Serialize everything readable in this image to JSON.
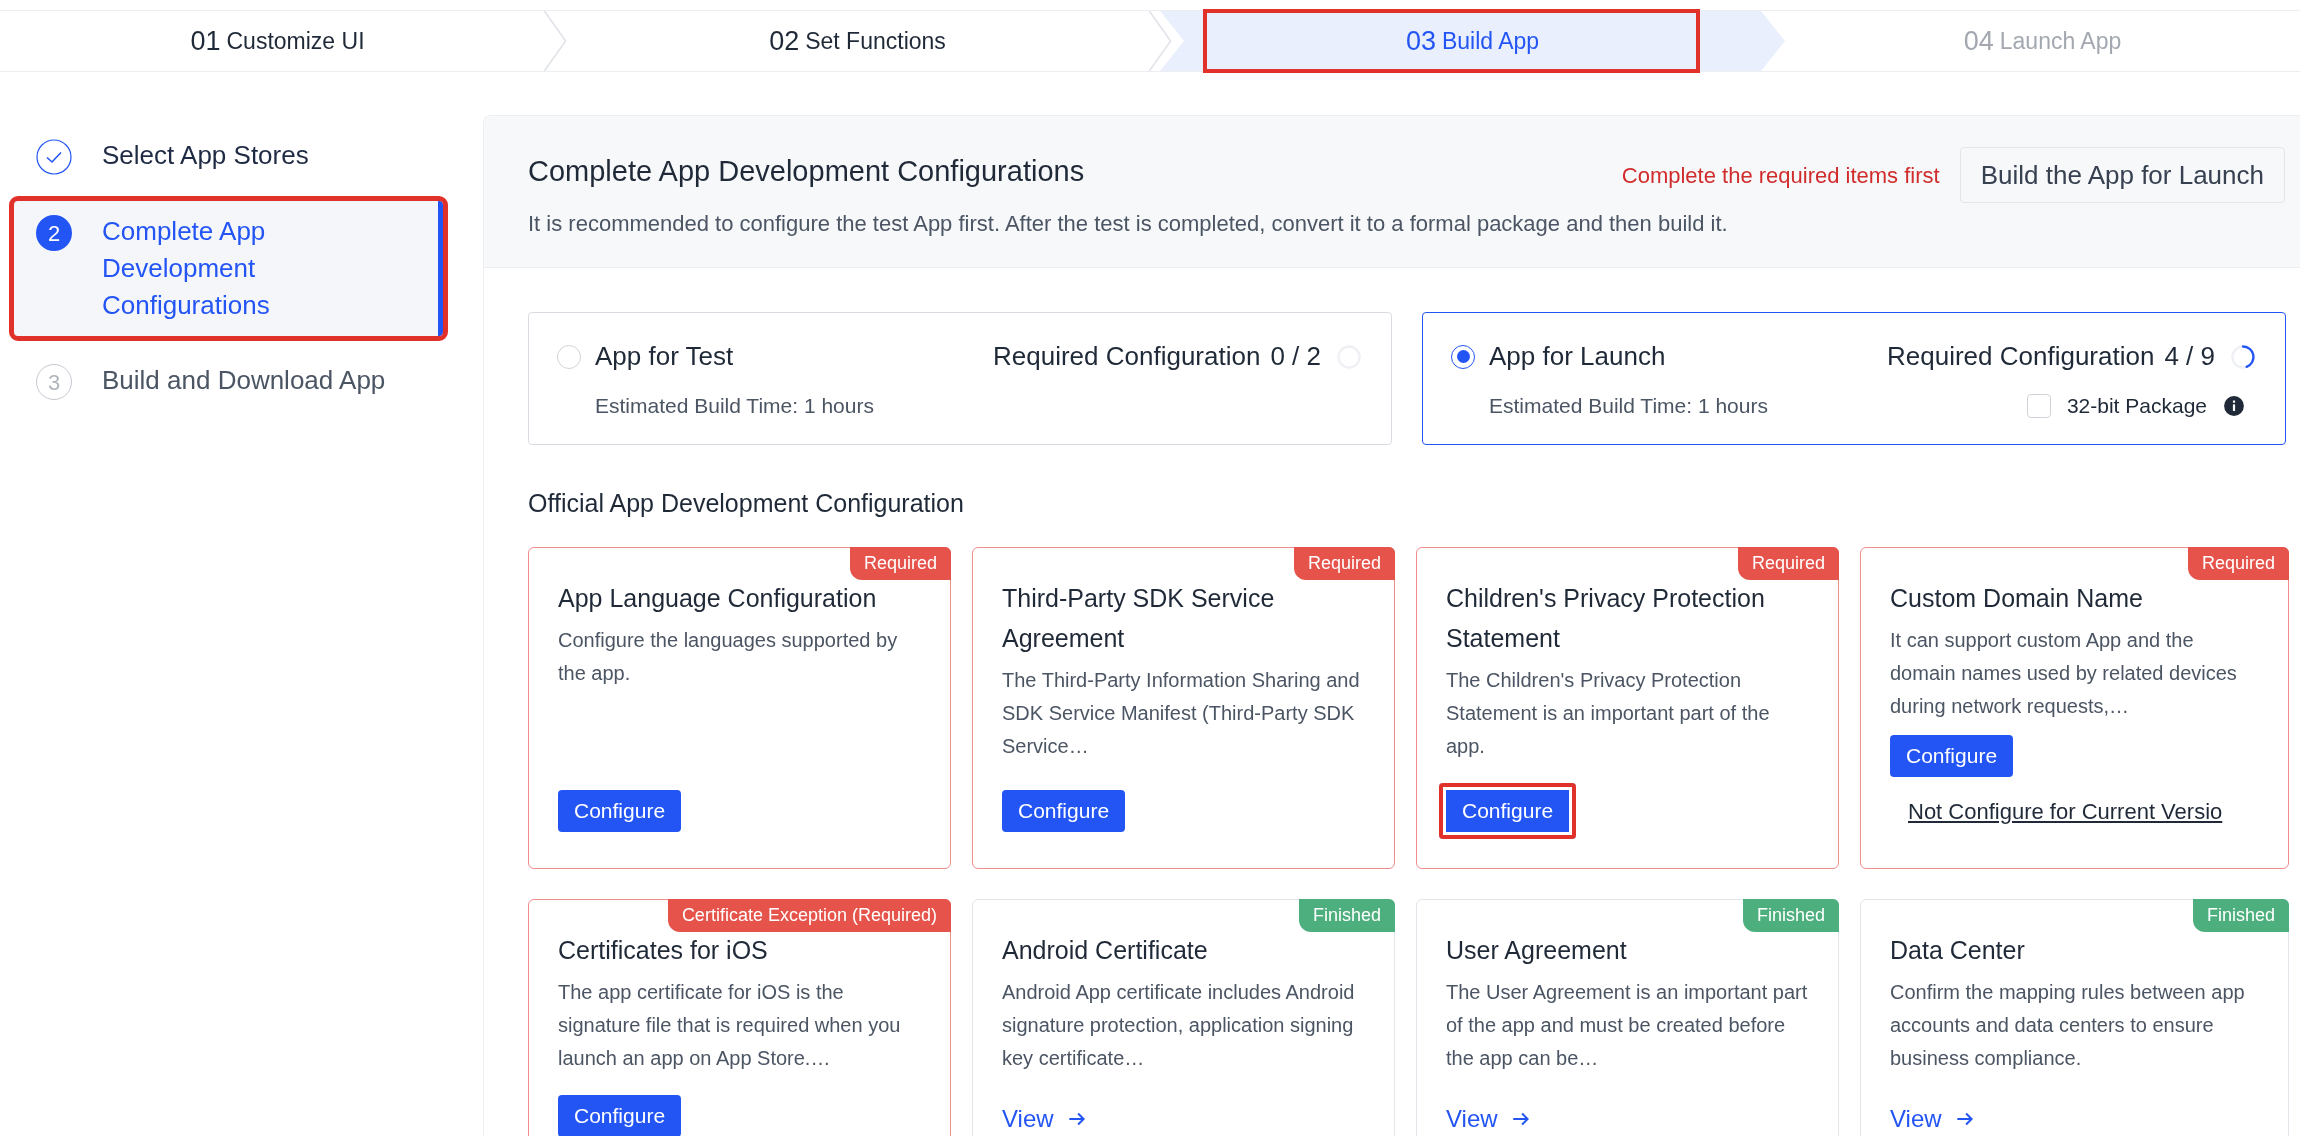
{
  "steps": [
    {
      "number": "01",
      "label": "Customize UI",
      "selected": false,
      "disabled": false,
      "highlighted": false
    },
    {
      "number": "02",
      "label": "Set Functions",
      "selected": false,
      "disabled": false,
      "highlighted": false
    },
    {
      "number": "03",
      "label": "Build App",
      "selected": true,
      "disabled": false,
      "highlighted": true
    },
    {
      "number": "04",
      "label": "Launch App",
      "selected": false,
      "disabled": true,
      "highlighted": false
    }
  ],
  "sidebar": {
    "items": [
      {
        "label": "Select App Stores",
        "completed": true,
        "selected": false,
        "highlighted": false
      },
      {
        "marker": "2",
        "label": "Complete App Development Configurations",
        "completed": false,
        "selected": true,
        "highlighted": true
      },
      {
        "marker": "3",
        "label": "Build and Download App",
        "completed": false,
        "selected": false,
        "highlighted": false
      }
    ]
  },
  "header": {
    "title": "Complete App Development Configurations",
    "subtitle": "It is recommended to configure the test App first. After the test is completed, convert it to a formal package and then build it.",
    "warning": "Complete the required items first",
    "build_button": "Build the App for Launch"
  },
  "app_types": [
    {
      "label": "App for Test",
      "selected": false,
      "required_label": "Required Configuration",
      "count": "0 / 2",
      "level": 0,
      "build_time": "Estimated Build Time: 1 hours"
    },
    {
      "label": "App for Launch",
      "selected": true,
      "required_label": "Required Configuration",
      "count": "4 / 9",
      "level": 0.444,
      "build_time": "Estimated Build Time: 1 hours",
      "option": {
        "label": "32-bit Package",
        "checked": false
      }
    }
  ],
  "section_title": "Official App Development Configuration",
  "cards": [
    {
      "title": "App Language Configuration",
      "badge": {
        "text": "Required",
        "kind": "required"
      },
      "description": "Configure the languages supported by the app.",
      "action": {
        "kind": "button",
        "label": "Configure",
        "highlighted": false
      }
    },
    {
      "title": "Third-Party SDK Service Agreement",
      "badge": {
        "text": "Required",
        "kind": "required"
      },
      "description": "The Third-Party Information Sharing and SDK Service Manifest (Third-Party SDK Service…",
      "action": {
        "kind": "button",
        "label": "Configure",
        "highlighted": false
      }
    },
    {
      "title": "Children's Privacy Protection Statement",
      "badge": {
        "text": "Required",
        "kind": "required"
      },
      "description": "The Children's Privacy Protection Statement is an important part of the app.",
      "action": {
        "kind": "button",
        "label": "Configure",
        "highlighted": true
      }
    },
    {
      "title": "Custom Domain Name",
      "badge": {
        "text": "Required",
        "kind": "required"
      },
      "description": "It can support custom App and the domain names used by related devices during network requests,…",
      "action": {
        "kind": "button",
        "label": "Configure",
        "highlighted": false
      },
      "extra_link": "Not Configure for Current Versio"
    },
    {
      "title": "Certificates for iOS",
      "badge": {
        "text": "Certificate Exception (Required)",
        "kind": "required"
      },
      "description": "The app certificate for iOS is the signature file that is required when you launch an app on App Store.…",
      "action": {
        "kind": "button",
        "label": "Configure",
        "highlighted": false
      }
    },
    {
      "title": "Android Certificate",
      "badge": {
        "text": "Finished",
        "kind": "finished"
      },
      "description": "Android App certificate includes Android signature protection, application signing key certificate…",
      "action": {
        "kind": "link",
        "label": "View"
      }
    },
    {
      "title": "User Agreement",
      "badge": {
        "text": "Finished",
        "kind": "finished"
      },
      "description": "The User Agreement is an important part of the app and must be created before the app can be…",
      "action": {
        "kind": "link",
        "label": "View"
      }
    },
    {
      "title": "Data Center",
      "badge": {
        "text": "Finished",
        "kind": "finished"
      },
      "description": "Confirm the mapping rules between app accounts and data centers to ensure business compliance.",
      "action": {
        "kind": "link",
        "label": "View"
      }
    }
  ]
}
